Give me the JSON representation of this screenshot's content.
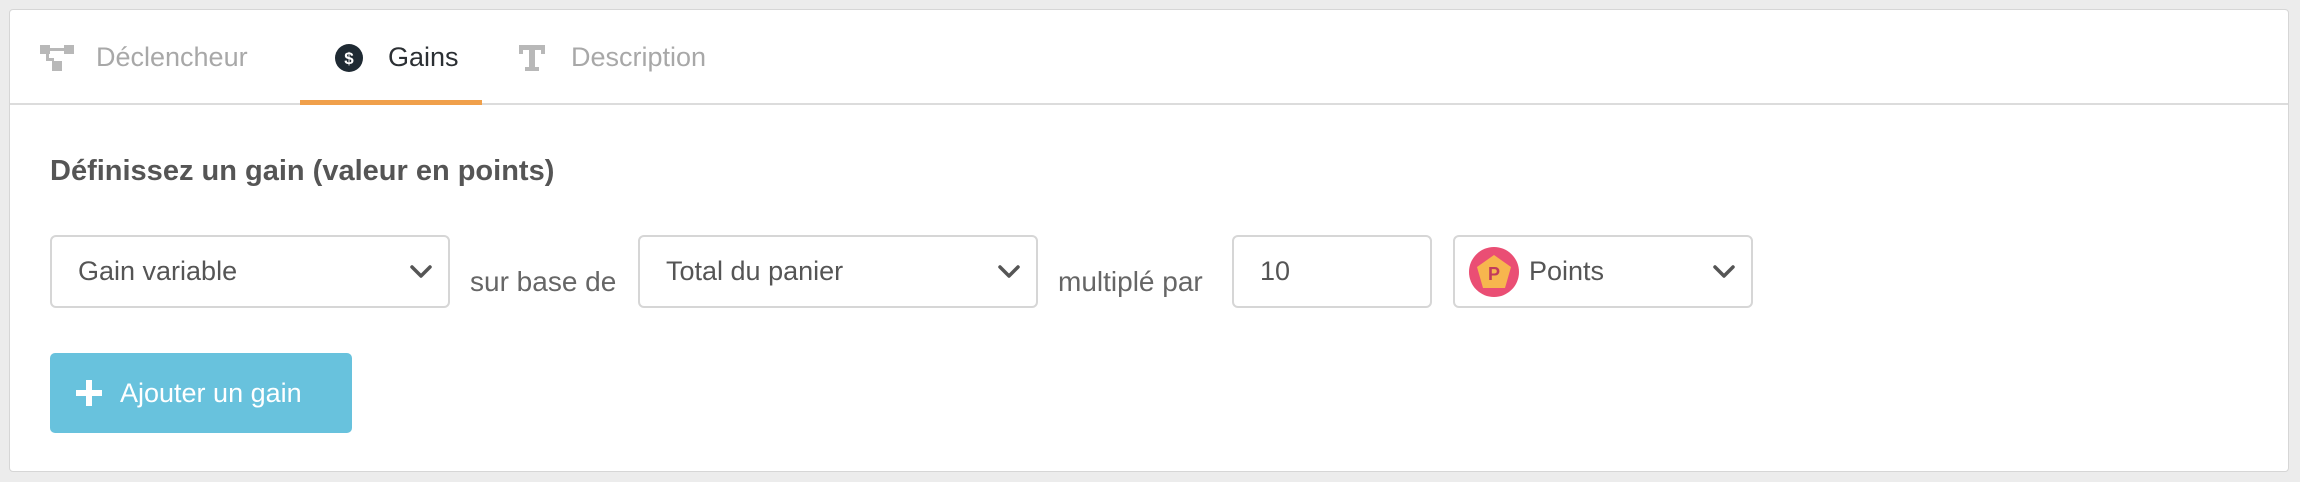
{
  "tabs": [
    {
      "label": "Déclencheur",
      "icon": "sitemap-icon",
      "active": false
    },
    {
      "label": "Gains",
      "icon": "dollar-circle-icon",
      "active": true
    },
    {
      "label": "Description",
      "icon": "text-icon",
      "active": false
    }
  ],
  "form": {
    "title": "Définissez un gain (valeur en points)",
    "gain_type": {
      "selected": "Gain variable"
    },
    "connector_base": "sur base de",
    "base": {
      "selected": "Total du panier"
    },
    "connector_multiply": "multiplé par",
    "multiplier": {
      "value": "10"
    },
    "currency": {
      "selected": "Points",
      "badge_letter": "P",
      "icon": "points-badge-icon"
    }
  },
  "actions": {
    "add_gain_label": "Ajouter un gain",
    "add_icon": "plus-icon"
  },
  "colors": {
    "accent_tab": "#f0a04b",
    "button": "#68c2dd",
    "badge": "#ea4e74",
    "badge_star": "#f7b64e"
  }
}
